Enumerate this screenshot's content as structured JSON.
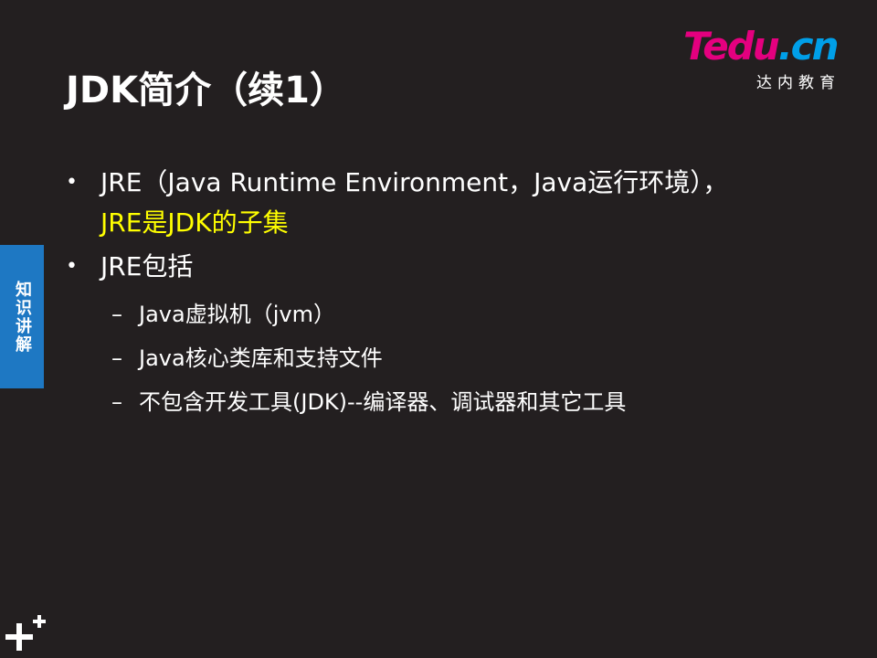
{
  "title": "JDK简介（续1）",
  "logo": {
    "word_t": "T",
    "word_rest": "edu",
    "word_dot": ".",
    "word_cn": "cn",
    "subtitle": "达内教育",
    "brand_pink": "#e4007f",
    "brand_blue": "#009fe8"
  },
  "side_tab": {
    "label": "知识讲解",
    "color": "#1e78c3"
  },
  "bullets": [
    {
      "mark": "•",
      "text": "JRE（Java Runtime Environment，Java运行环境），",
      "highlight": "JRE是JDK的子集"
    },
    {
      "mark": "•",
      "text": "JRE包括"
    }
  ],
  "sub_items": [
    {
      "dash": "–",
      "text": "Java虚拟机（jvm）"
    },
    {
      "dash": "–",
      "text": "Java核心类库和支持文件"
    },
    {
      "dash": "–",
      "text": "不包含开发工具(JDK)--编译器、调试器和其它工具"
    }
  ],
  "colors": {
    "background": "#231f20",
    "text": "#ffffff",
    "highlight": "#ffff00"
  },
  "footer_icon": "plus-icon"
}
